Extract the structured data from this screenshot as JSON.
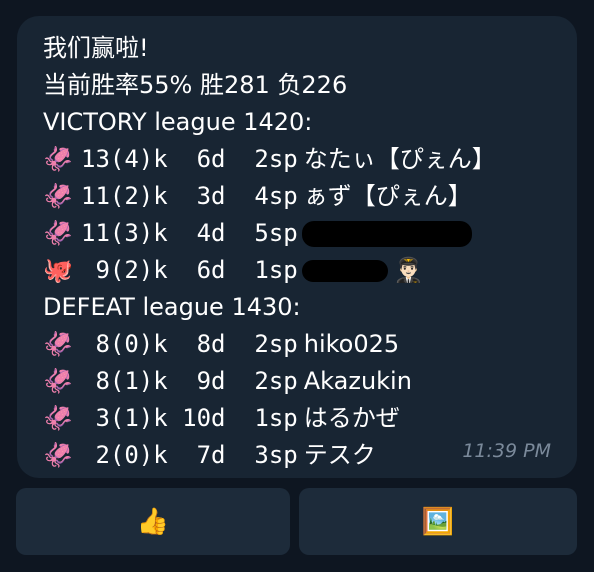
{
  "message": {
    "header": "我们赢啦!",
    "winrate": "当前胜率55%  胜281  负226",
    "victory_title": "VICTORY league 1420:",
    "victory_rows": [
      {
        "emoji": "🦑",
        "stats": "13(4)k  6d  2sp",
        "name": "なたぃ【ぴぇん】"
      },
      {
        "emoji": "🦑",
        "stats": "11(2)k  3d  4sp",
        "name": "ぁず【ぴぇん】"
      },
      {
        "emoji": "🦑",
        "stats": "11(3)k  4d  5sp",
        "name": ""
      },
      {
        "emoji": "🐙",
        "stats": " 9(2)k  6d  1sp",
        "name": "",
        "trail_emoji": "👨🏻‍✈️"
      }
    ],
    "defeat_title": "DEFEAT league 1430:",
    "defeat_rows": [
      {
        "emoji": "🦑",
        "stats": " 8(0)k  8d  2sp",
        "name": "hiko025"
      },
      {
        "emoji": "🦑",
        "stats": " 8(1)k  9d  2sp",
        "name": "Akazukin"
      },
      {
        "emoji": "🦑",
        "stats": " 3(1)k 10d  1sp",
        "name": "はるかぜ"
      },
      {
        "emoji": "🦑",
        "stats": " 2(0)k  7d  3sp",
        "name": "テスク"
      }
    ],
    "time": "11:39 PM"
  },
  "buttons": {
    "like": "👍",
    "picture": "🖼️"
  }
}
